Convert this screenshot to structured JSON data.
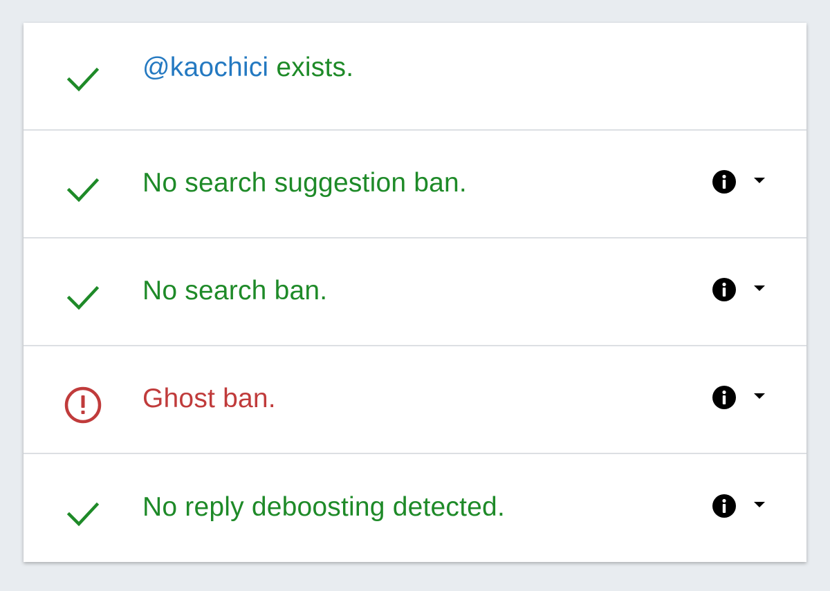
{
  "rows": [
    {
      "status": "ok",
      "icon": "checkmark-icon",
      "handle": "@kaochici",
      "text": "exists.",
      "has_actions": false
    },
    {
      "status": "ok",
      "icon": "checkmark-icon",
      "text": "No search suggestion ban.",
      "has_actions": true
    },
    {
      "status": "ok",
      "icon": "checkmark-icon",
      "text": "No search ban.",
      "has_actions": true
    },
    {
      "status": "bad",
      "icon": "alert-circle-icon",
      "text": "Ghost ban.",
      "has_actions": true
    },
    {
      "status": "ok",
      "icon": "checkmark-icon",
      "text": "No reply deboosting detected.",
      "has_actions": true
    }
  ],
  "colors": {
    "ok": "#1e8a28",
    "bad": "#c03b3b",
    "handle": "#2479c1",
    "background": "#e8ecf0",
    "card": "#ffffff",
    "divider": "#dcdfe3"
  }
}
